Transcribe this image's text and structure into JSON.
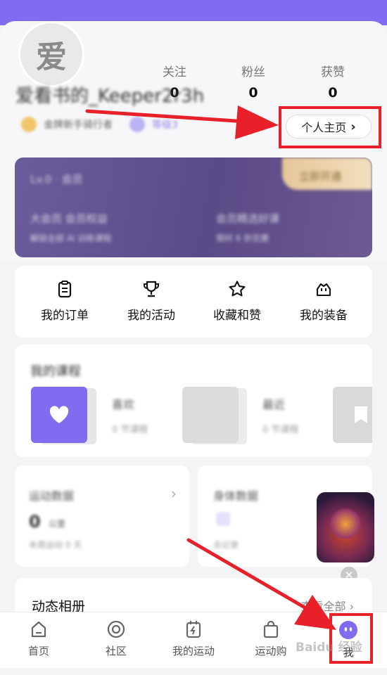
{
  "profile": {
    "avatar_char": "爱",
    "username": "爱看书的_Keeper2r3h",
    "badge1": "金牌新手骑行者",
    "badge2": "等级3",
    "homepage_button": "个人主页",
    "stats": [
      {
        "label": "关注",
        "value": "0"
      },
      {
        "label": "粉丝",
        "value": "0"
      },
      {
        "label": "获赞",
        "value": "0"
      }
    ]
  },
  "vip": {
    "level": "Lv.0 · 会员",
    "cta": "立即开通",
    "left_title": "大会员",
    "left_sub": "会员权益",
    "left_desc": "解锁全部 AI 训练课程",
    "right_title": "会员精选好课",
    "right_desc": "限时 6 折优惠"
  },
  "quick_actions": [
    {
      "label": "我的订单",
      "icon": "clipboard-icon"
    },
    {
      "label": "我的活动",
      "icon": "trophy-icon"
    },
    {
      "label": "收藏和赞",
      "icon": "star-icon"
    },
    {
      "label": "我的装备",
      "icon": "bag-icon"
    }
  ],
  "courses": {
    "title": "我的课程",
    "items": [
      {
        "name": "喜欢",
        "meta": "0 节课程"
      },
      {
        "name": "最近",
        "meta": "0 节课程"
      }
    ]
  },
  "left_card": {
    "title": "运动数据",
    "value": "0",
    "unit": "公里",
    "desc": "本周运动 0 天"
  },
  "right_card": {
    "title": "身体数据",
    "desc": "去记录"
  },
  "album": {
    "title": "动态相册",
    "more": "查看全部"
  },
  "tabs": [
    {
      "label": "首页",
      "icon": "home-icon"
    },
    {
      "label": "社区",
      "icon": "community-icon"
    },
    {
      "label": "我的运动",
      "icon": "sport-icon"
    },
    {
      "label": "运动购",
      "icon": "shop-icon"
    },
    {
      "label": "我",
      "icon": "me-icon"
    }
  ],
  "watermark": "Baidu 经验",
  "colors": {
    "accent": "#7f6cf0",
    "annotation": "#e8202a"
  }
}
